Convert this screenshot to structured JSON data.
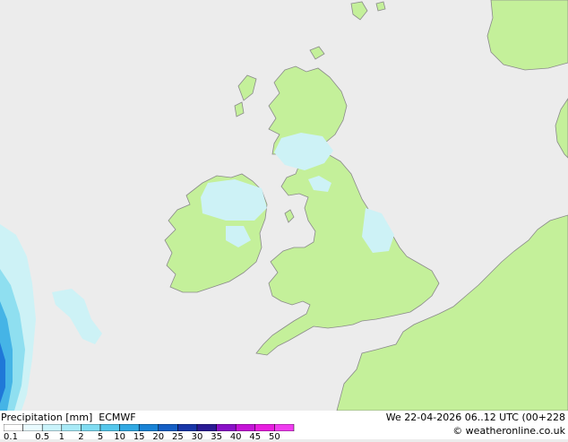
{
  "map": {
    "colors": {
      "sea": "#ececec",
      "land": "#c4f09a",
      "coast": "#8a8a8a",
      "rain_light": "#cdf2f6",
      "rain_med": "#8fdff0",
      "rain_heavy": "#45b4e6",
      "rain_deep": "#1f78d8"
    }
  },
  "legend": {
    "title": "Precipitation [mm]",
    "model": "ECMWF",
    "valid_time": "We 22-04-2026 06..12 UTC (00+228",
    "credit": "© weatheronline.co.uk",
    "ticks": [
      "0.1",
      "0.5",
      "1",
      "2",
      "5",
      "10",
      "15",
      "20",
      "25",
      "30",
      "35",
      "40",
      "45",
      "50"
    ],
    "scale_colors": [
      "#ffffff",
      "#e9fbff",
      "#c9f3fb",
      "#a8eaf7",
      "#80dcf2",
      "#55c7ec",
      "#31a9e3",
      "#1983d6",
      "#155fc5",
      "#1836a8",
      "#2a1a94",
      "#8a10c8",
      "#c514d8",
      "#e81ee0",
      "#f03cf0"
    ]
  }
}
